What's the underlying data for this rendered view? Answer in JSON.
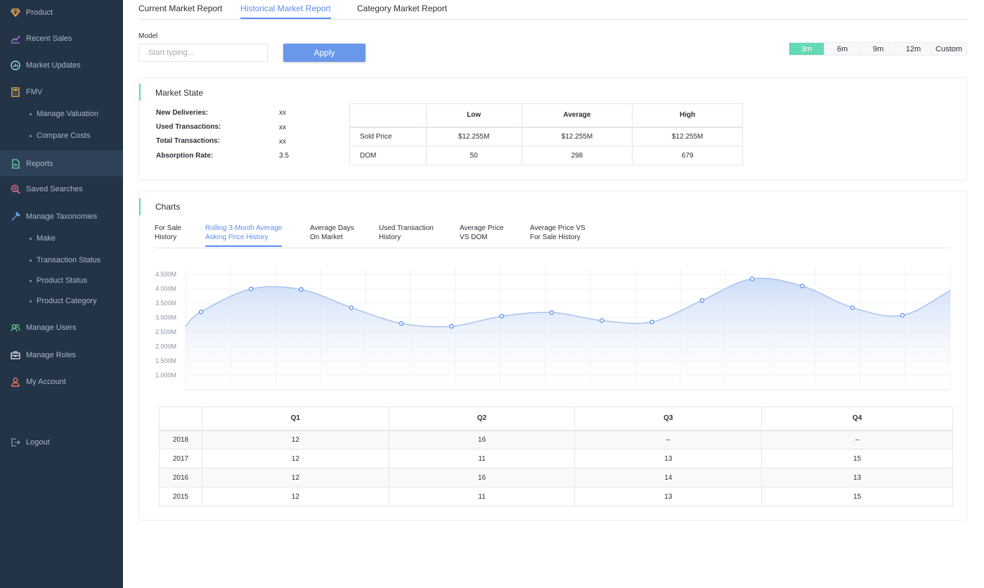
{
  "sidebar": {
    "items": [
      {
        "label": "Product",
        "icon": "gem-icon"
      },
      {
        "label": "Recent Sales",
        "icon": "trend-icon"
      },
      {
        "label": "Market Updates",
        "icon": "chart-circle-icon"
      },
      {
        "label": "FMV",
        "icon": "calculator-icon"
      },
      {
        "label": "Reports",
        "icon": "report-icon"
      },
      {
        "label": "Saved Searches",
        "icon": "search-icon"
      },
      {
        "label": "Manage Taxonomies",
        "icon": "wrench-icon"
      },
      {
        "label": "Manage Users",
        "icon": "users-icon"
      },
      {
        "label": "Manage Roles",
        "icon": "briefcase-icon"
      },
      {
        "label": "My Account",
        "icon": "user-icon"
      },
      {
        "label": "Logout",
        "icon": "logout-icon"
      }
    ],
    "fmv_sub": [
      "Manage Valuation",
      "Compare Costs"
    ],
    "taxonomy_sub": [
      "Make",
      "Transaction Status",
      "Product Status",
      "Product Category"
    ]
  },
  "tabs": [
    "Current Market Report",
    "Historical Market Report",
    "Category Market Report"
  ],
  "active_tab": "Historical Market Report",
  "filter": {
    "model_label": "Model",
    "model_placeholder": "Start typing...",
    "model_value": "",
    "apply_label": "Apply"
  },
  "ranges": [
    "3m",
    "6m",
    "9m",
    "12m",
    "Custom"
  ],
  "active_range": "3m",
  "market_state": {
    "title": "Market State",
    "stats": [
      {
        "label": "New Deliveries:",
        "value": "xx"
      },
      {
        "label": "Used Transactions:",
        "value": "xx"
      },
      {
        "label": "Total Transactions:",
        "value": "xx"
      },
      {
        "label": "Absorption Rate:",
        "value": "3.5"
      }
    ],
    "table": {
      "headers": [
        "",
        "Low",
        "Average",
        "High"
      ],
      "rows": [
        [
          "Sold Price",
          "$12.255M",
          "$12.255M",
          "$12.255M"
        ],
        [
          "DOM",
          "50",
          "298",
          "679"
        ]
      ]
    }
  },
  "charts": {
    "title": "Charts",
    "tabs": [
      {
        "line1": "For Sale",
        "line2": "History"
      },
      {
        "line1": "Rolling 3-Month Average",
        "line2": "Asking Price History"
      },
      {
        "line1": "Average Days",
        "line2": "On Market"
      },
      {
        "line1": "Used Transaction",
        "line2": "History"
      },
      {
        "line1": "Average Price",
        "line2": "VS DOM"
      },
      {
        "line1": "Average Price VS",
        "line2": "For Sale History"
      }
    ],
    "active_index": 1,
    "table": {
      "headers": [
        "",
        "Q1",
        "Q2",
        "Q3",
        "Q4"
      ],
      "rows": [
        [
          "2018",
          "12",
          "16",
          "–",
          "–"
        ],
        [
          "2017",
          "12",
          "11",
          "13",
          "15"
        ],
        [
          "2016",
          "12",
          "16",
          "14",
          "13"
        ],
        [
          "2015",
          "12",
          "11",
          "13",
          "15"
        ]
      ]
    }
  },
  "chart_data": {
    "type": "area",
    "yticks": [
      "4.500M",
      "4.000M",
      "3.500M",
      "3.000M",
      "2.500M",
      "2.000M",
      "1.500M",
      "1.000M"
    ],
    "ylim": [
      0.5,
      4.75
    ],
    "ylabel": "",
    "xlabel": "",
    "points": [
      3.2,
      4.0,
      3.98,
      3.35,
      2.8,
      2.7,
      3.05,
      3.18,
      2.9,
      2.85,
      3.6,
      4.35,
      4.1,
      3.35,
      3.08
    ],
    "line_start": 2.7,
    "line_end": 3.95,
    "colors": {
      "line": "#a9c3ef",
      "point": "#5b8def",
      "fill_top": "#c6d8f6",
      "fill_bottom": "#ffffff"
    }
  }
}
